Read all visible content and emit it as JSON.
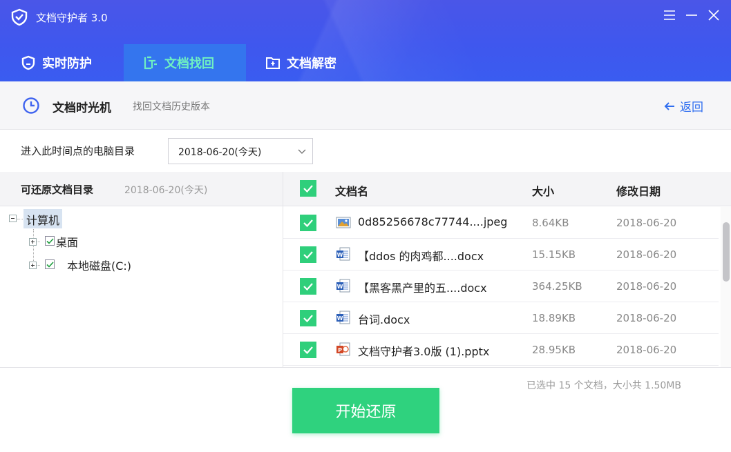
{
  "app": {
    "title": "文档守护者 3.0"
  },
  "tabs": [
    {
      "label": "实时防护",
      "icon": "shield-icon",
      "active": false
    },
    {
      "label": "文档找回",
      "icon": "recover-icon",
      "active": true
    },
    {
      "label": "文档解密",
      "icon": "folder-unlock-icon",
      "active": false
    }
  ],
  "subheader": {
    "title": "文档时光机",
    "description": "找回文档历史版本",
    "back_label": "返回"
  },
  "date_picker": {
    "label": "进入此时间点的电脑目录",
    "selected": "2018-06-20(今天)"
  },
  "tree_panel": {
    "title": "可还原文档目录",
    "date": "2018-06-20(今天)",
    "root": "计算机",
    "children": [
      {
        "label": "桌面",
        "checked": true
      },
      {
        "label": "本地磁盘(C:)",
        "checked": true
      }
    ]
  },
  "file_table": {
    "columns": {
      "name": "文档名",
      "size": "大小",
      "date": "修改日期"
    },
    "rows": [
      {
        "name": "0d85256678c77744....jpeg",
        "size": "8.64KB",
        "date": "2018-06-20",
        "type": "image",
        "checked": true
      },
      {
        "name": "【ddos 的肉鸡都....docx",
        "size": "15.15KB",
        "date": "2018-06-20",
        "type": "word",
        "checked": true
      },
      {
        "name": "【黑客黑产里的五....docx",
        "size": "364.25KB",
        "date": "2018-06-20",
        "type": "word",
        "checked": true
      },
      {
        "name": "台词.docx",
        "size": "18.89KB",
        "date": "2018-06-20",
        "type": "word",
        "checked": true
      },
      {
        "name": "文档守护者3.0版 (1).pptx",
        "size": "28.95KB",
        "date": "2018-06-20",
        "type": "powerpoint",
        "checked": true
      }
    ]
  },
  "summary": "已选中 15 个文档，大小共 1.50MB",
  "action": {
    "start_label": "开始还原"
  },
  "colors": {
    "header": "#3f57ee",
    "active_tab": "#3475ee",
    "accent_green": "#2fd27e",
    "link_blue": "#2f6ef0"
  }
}
